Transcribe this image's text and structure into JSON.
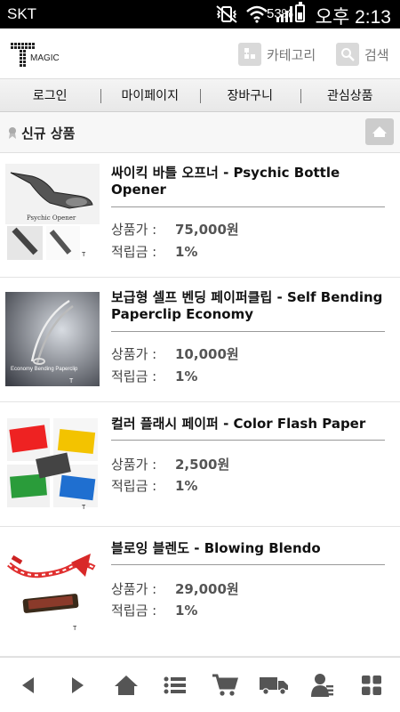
{
  "status_bar": {
    "carrier": "SKT",
    "battery_percent": "53%",
    "battery_level": 0.53,
    "time": "오후 2:13"
  },
  "header": {
    "logo_text": "MAGIC",
    "category_label": "카테고리",
    "search_label": "검색"
  },
  "nav": {
    "items": [
      {
        "label": "로그인"
      },
      {
        "label": "마이페이지"
      },
      {
        "label": "장바구니"
      },
      {
        "label": "관심상품"
      }
    ]
  },
  "section": {
    "title": "신규 상품"
  },
  "products": [
    {
      "name": "싸이킥 바틀 오프너 - Psychic Bottle Opener",
      "price_label": "상품가 :",
      "price": "75,000원",
      "points_label": "적립금 :",
      "points": "1%",
      "thumb_caption": "Psychic Opener"
    },
    {
      "name": "보급형 셀프 벤딩 페이퍼클립 - Self Bending Paperclip Economy",
      "price_label": "상품가 :",
      "price": "10,000원",
      "points_label": "적립금 :",
      "points": "1%",
      "thumb_caption": "Economy Bending Paperclip"
    },
    {
      "name": "컬러 플래시 페이퍼 - Color Flash Paper",
      "price_label": "상품가 :",
      "price": "2,500원",
      "points_label": "적립금 :",
      "points": "1%",
      "thumb_caption": ""
    },
    {
      "name": "블로잉 블렌도 - Blowing Blendo",
      "price_label": "상품가 :",
      "price": "29,000원",
      "points_label": "적립금 :",
      "points": "1%",
      "thumb_caption": ""
    }
  ],
  "toolbar": {
    "icons": [
      "back-arrow-icon",
      "forward-arrow-icon",
      "home-icon",
      "list-icon",
      "cart-icon",
      "delivery-truck-icon",
      "user-icon",
      "grid-icon"
    ]
  },
  "colors": {
    "status_bar_bg": "#000000",
    "nav_bg": "#eeeeee",
    "toolbar_icon": "#555555",
    "header_button": "#d9d9d9"
  }
}
